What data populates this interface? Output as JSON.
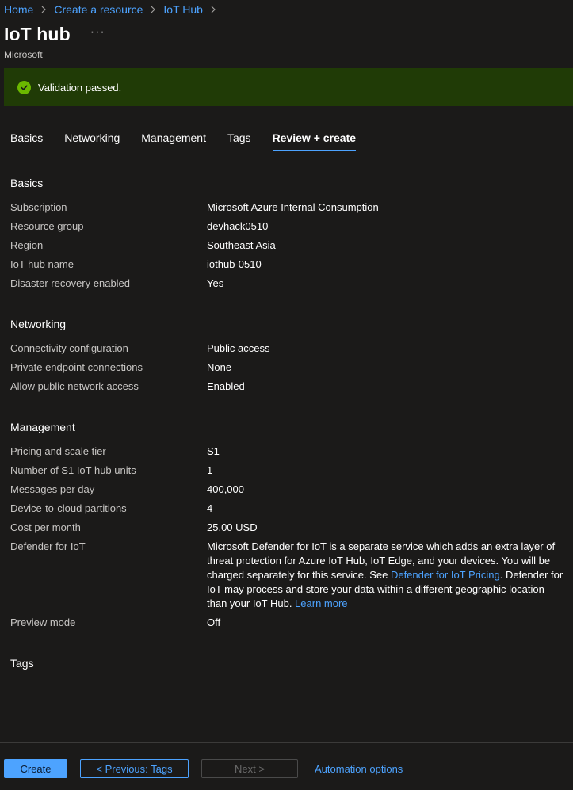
{
  "breadcrumb": [
    {
      "label": "Home"
    },
    {
      "label": "Create a resource"
    },
    {
      "label": "IoT Hub"
    }
  ],
  "title": "IoT hub",
  "more_label": "···",
  "publisher": "Microsoft",
  "banner": {
    "text": "Validation passed.",
    "status_color": "#6bb700"
  },
  "tabs": [
    {
      "label": "Basics"
    },
    {
      "label": "Networking"
    },
    {
      "label": "Management"
    },
    {
      "label": "Tags"
    },
    {
      "label": "Review + create",
      "active": true
    }
  ],
  "basics": {
    "title": "Basics",
    "rows": [
      {
        "label": "Subscription",
        "value": "Microsoft Azure Internal Consumption"
      },
      {
        "label": "Resource group",
        "value": "devhack0510"
      },
      {
        "label": "Region",
        "value": "Southeast Asia"
      },
      {
        "label": "IoT hub name",
        "value": "iothub-0510"
      },
      {
        "label": "Disaster recovery enabled",
        "value": "Yes"
      }
    ]
  },
  "networking": {
    "title": "Networking",
    "rows": [
      {
        "label": "Connectivity configuration",
        "value": "Public access"
      },
      {
        "label": "Private endpoint connections",
        "value": "None"
      },
      {
        "label": "Allow public network access",
        "value": "Enabled"
      }
    ]
  },
  "management": {
    "title": "Management",
    "rows": [
      {
        "label": "Pricing and scale tier",
        "value": "S1"
      },
      {
        "label": "Number of S1 IoT hub units",
        "value": "1"
      },
      {
        "label": "Messages per day",
        "value": "400,000"
      },
      {
        "label": "Device-to-cloud partitions",
        "value": "4"
      },
      {
        "label": "Cost per month",
        "value": "25.00 USD"
      }
    ],
    "defender": {
      "label": "Defender for IoT",
      "text_1": "Microsoft Defender for IoT is a separate service which adds an extra layer of threat protection for Azure IoT Hub, IoT Edge, and your devices. You will be charged separately for this service. See ",
      "link_1": "Defender for IoT Pricing",
      "text_2": ". Defender for IoT may process and store your data within a different geographic location than your IoT Hub. ",
      "link_2": "Learn more"
    },
    "preview": {
      "label": "Preview mode",
      "value": "Off"
    }
  },
  "tags": {
    "title": "Tags"
  },
  "footer": {
    "create": "Create",
    "previous": "< Previous: Tags",
    "next": "Next >",
    "automation": "Automation options"
  }
}
